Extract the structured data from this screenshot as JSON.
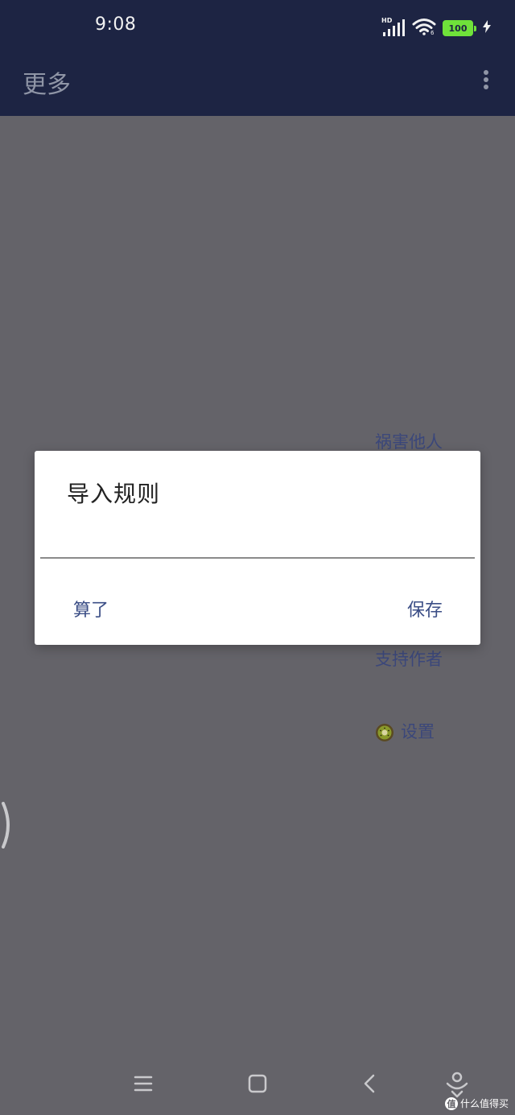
{
  "status_bar": {
    "time": "9:08",
    "network_label": "HD",
    "battery_level": "100",
    "battery_color": "#6fe23a"
  },
  "app_bar": {
    "title": "更多",
    "menu_icon": "overflow-menu-icon"
  },
  "background_menu": {
    "items": [
      {
        "label": "祸害他人"
      },
      {
        "label": "支持作者"
      },
      {
        "label": "设置",
        "icon": "kiwi-icon"
      }
    ]
  },
  "dialog": {
    "title": "导入规则",
    "input_value": "",
    "cancel_label": "算了",
    "save_label": "保存"
  },
  "nav_bar": {
    "icons": [
      "menu-icon",
      "home-icon",
      "back-icon",
      "assistant-icon"
    ]
  },
  "watermark": {
    "badge": "值",
    "text": "什么值得买"
  },
  "colors": {
    "app_bar_background": "#1d2443",
    "scrim_background": "#646369",
    "accent_text": "#3b4e86"
  }
}
